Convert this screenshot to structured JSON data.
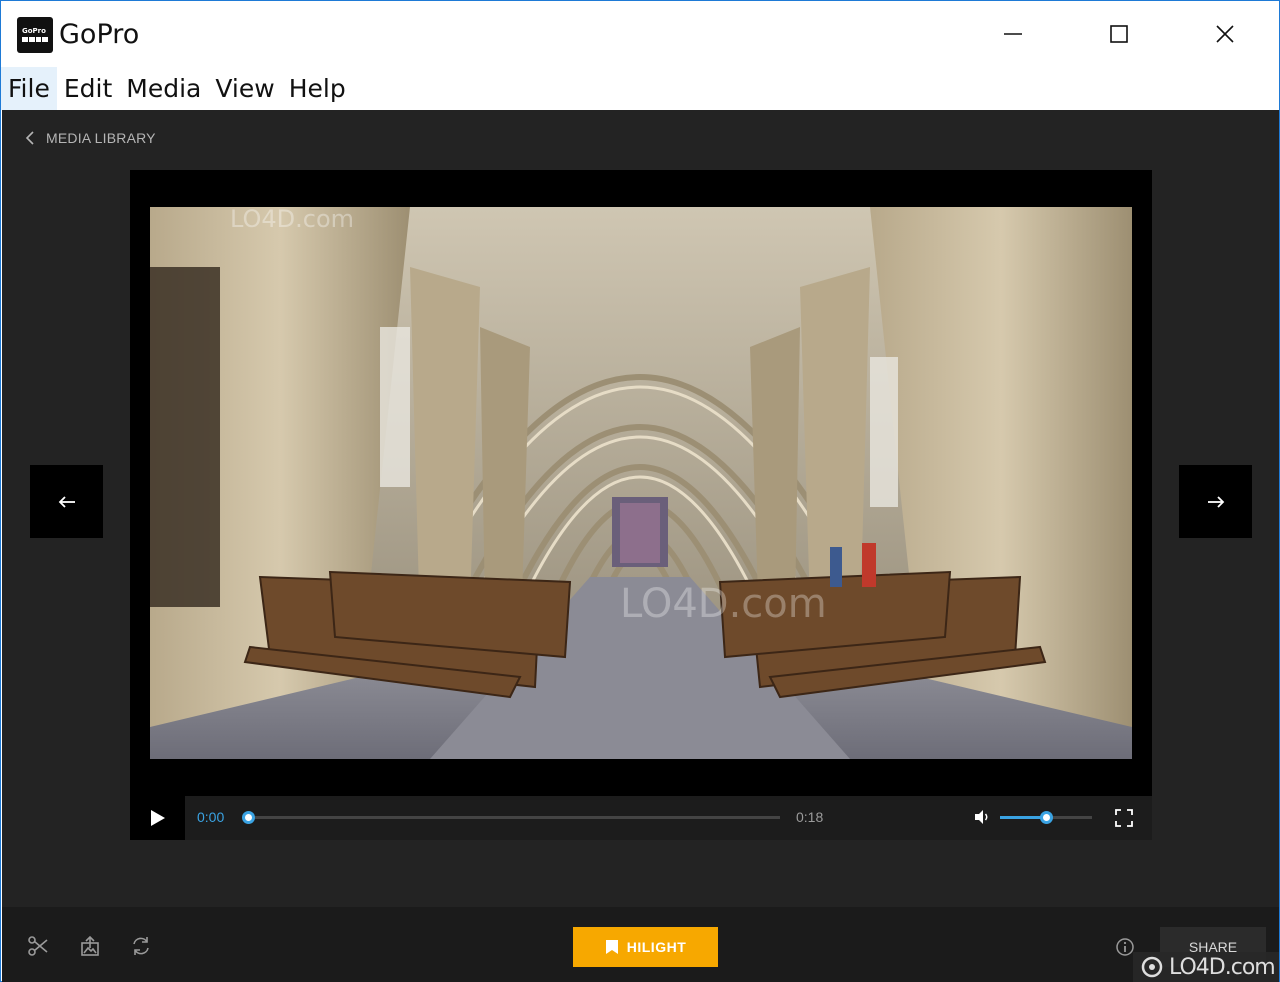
{
  "window": {
    "title": "GoPro",
    "logo_text": "GoPro"
  },
  "menu": {
    "items": [
      "File",
      "Edit",
      "Media",
      "View",
      "Help"
    ]
  },
  "nav": {
    "back_label": "MEDIA LIBRARY"
  },
  "player": {
    "current_time": "0:00",
    "duration": "0:18",
    "progress": 0.0,
    "volume": 0.5,
    "watermark_text": "LO4D.com"
  },
  "bottom": {
    "hilight_label": "HILIGHT",
    "share_label": "SHARE"
  },
  "colors": {
    "accent": "#3aa3e3",
    "hilight": "#f7a800",
    "background": "#232323"
  },
  "watermark": {
    "text": "LO4D.com"
  }
}
